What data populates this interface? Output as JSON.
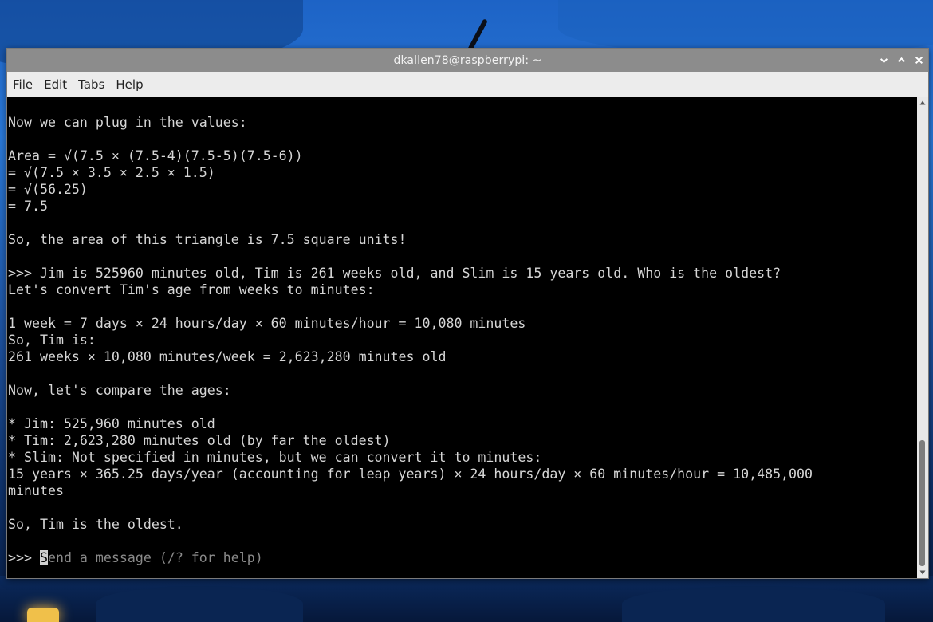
{
  "window": {
    "title": "dkallen78@raspberrypi: ~",
    "controls": [
      "minimize-icon",
      "maximize-icon",
      "close-icon"
    ]
  },
  "menubar": {
    "items": [
      {
        "label": "File"
      },
      {
        "label": "Edit"
      },
      {
        "label": "Tabs"
      },
      {
        "label": "Help"
      }
    ]
  },
  "terminal": {
    "lines": [
      "Now we can plug in the values:",
      "",
      "Area = √(7.5 × (7.5-4)(7.5-5)(7.5-6))",
      "= √(7.5 × 3.5 × 2.5 × 1.5)",
      "= √(56.25)",
      "= 7.5",
      "",
      "So, the area of this triangle is 7.5 square units!",
      "",
      ">>> Jim is 525960 minutes old, Tim is 261 weeks old, and Slim is 15 years old. Who is the oldest?",
      "Let's convert Tim's age from weeks to minutes:",
      "",
      "1 week = 7 days × 24 hours/day × 60 minutes/hour = 10,080 minutes",
      "So, Tim is:",
      "261 weeks × 10,080 minutes/week = 2,623,280 minutes old",
      "",
      "Now, let's compare the ages:",
      "",
      "* Jim: 525,960 minutes old",
      "* Tim: 2,623,280 minutes old (by far the oldest)",
      "* Slim: Not specified in minutes, but we can convert it to minutes:",
      "15 years × 365.25 days/year (accounting for leap years) × 24 hours/day × 60 minutes/hour = 10,485,000",
      "minutes",
      "",
      "So, Tim is the oldest.",
      ""
    ],
    "input": {
      "prompt": ">>> ",
      "cursor_char": "S",
      "placeholder_rest": "end a message (/? for help)"
    }
  }
}
